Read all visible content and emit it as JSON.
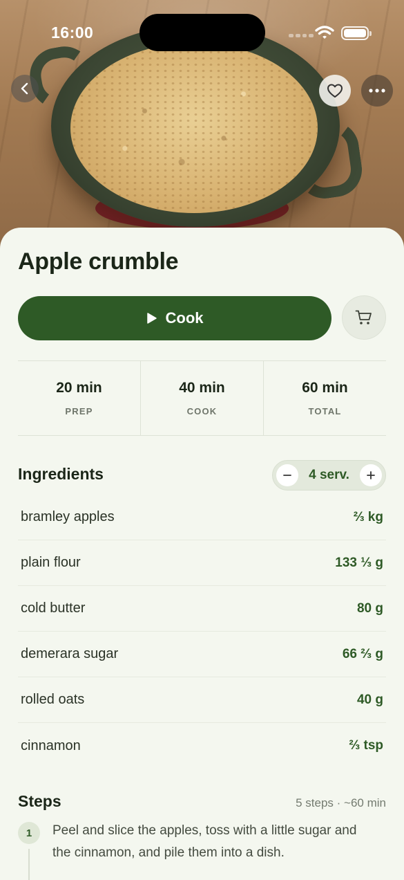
{
  "status_bar": {
    "time": "16:00"
  },
  "recipe": {
    "title": "Apple crumble"
  },
  "actions": {
    "cook_label": "Cook"
  },
  "times": [
    {
      "value": "20 min",
      "label": "PREP"
    },
    {
      "value": "40 min",
      "label": "COOK"
    },
    {
      "value": "60 min",
      "label": "TOTAL"
    }
  ],
  "ingredients": {
    "heading": "Ingredients",
    "servings": "4 serv.",
    "items": [
      {
        "name": "bramley apples",
        "qty": "⅔ kg"
      },
      {
        "name": "plain flour",
        "qty": "133 ⅓ g"
      },
      {
        "name": "cold butter",
        "qty": "80 g"
      },
      {
        "name": "demerara sugar",
        "qty": "66 ⅔ g"
      },
      {
        "name": "rolled oats",
        "qty": "40 g"
      },
      {
        "name": "cinnamon",
        "qty": "⅔ tsp"
      }
    ]
  },
  "steps": {
    "heading": "Steps",
    "meta": "5 steps · ~60 min",
    "items": [
      {
        "number": "1",
        "text": "Peel and slice the apples, toss with a little sugar and the cinnamon, and pile them into a dish."
      }
    ]
  },
  "colors": {
    "accent": "#2e5a26",
    "background": "#f4f7ef"
  },
  "icons": [
    "back-chevron-icon",
    "heart-icon",
    "more-dots-icon",
    "play-icon",
    "cart-icon",
    "minus-icon",
    "plus-icon",
    "wifi-icon",
    "battery-icon"
  ]
}
